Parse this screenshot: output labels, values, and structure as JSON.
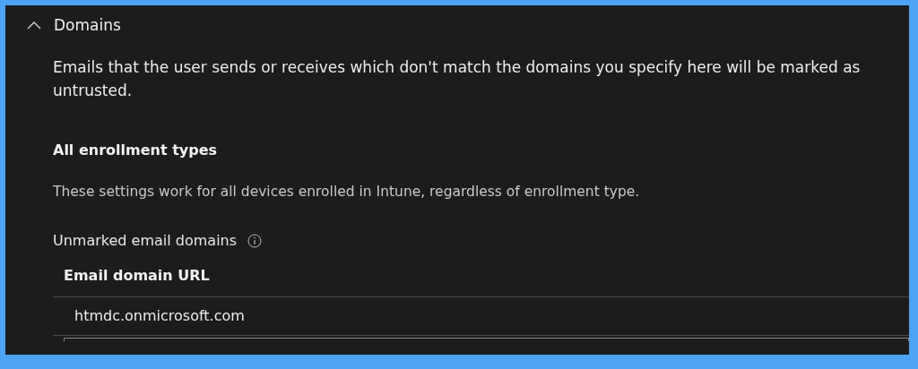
{
  "section": {
    "title": "Domains",
    "expanded": true,
    "description": "Emails that the user sends or receives which don't match the domains you specify here will be marked as untrusted."
  },
  "group": {
    "title": "All enrollment types",
    "description": "These settings work for all devices enrolled in Intune, regardless of enrollment type."
  },
  "setting": {
    "label": "Unmarked email domains"
  },
  "table": {
    "columns": [
      "Email domain URL"
    ],
    "rows": [
      [
        "htmdc.onmicrosoft.com"
      ]
    ]
  }
}
